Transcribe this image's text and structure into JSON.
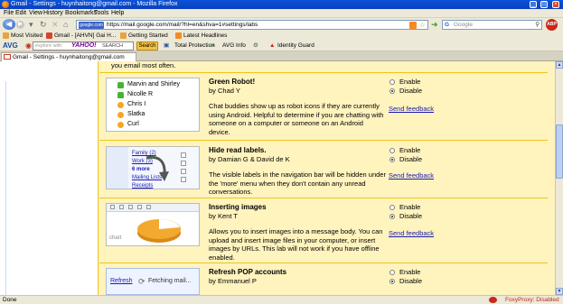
{
  "window": {
    "title": "Gmail - Settings - huynhaitong@gmail.com - Mozilla Firefox",
    "min": "_",
    "max": "□",
    "close": "×"
  },
  "menu": [
    "File",
    "Edit",
    "View",
    "History",
    "Bookmarks",
    "Tools",
    "Help"
  ],
  "nav": {
    "url": "https://mail.google.com/mail/?hl=en&shva=1#settings/labs",
    "site_badge": "google.com",
    "search_placeholder": "Google",
    "search_engine_letter": "G",
    "abp_label": "ABP"
  },
  "bookmarks": [
    "Most Visited",
    "Gmail - [AHVN] Gai H...",
    "Getting Started",
    "Latest Headlines"
  ],
  "toolbar": {
    "avg_label": "AVG",
    "yahoo_placeholder": "explore with",
    "yahoo_brand": "YAHOO!",
    "yahoo_search_label": "SEARCH",
    "search_button": "Search",
    "items": [
      "Total Protection",
      "AVG Info",
      "Identity Guard"
    ]
  },
  "tab": {
    "title": "Gmail - Settings - huynhaitong@gmail.com"
  },
  "content": {
    "top_text": "you email most often.",
    "labs": [
      {
        "title": "Green Robot!",
        "author": "by Chad Y",
        "description": "Chat buddies show up as robot icons if they are currently using Android. Helpful to determine if you are chatting with someone on a computer or someone on an Android device.",
        "enable": "Enable",
        "disable": "Disable",
        "selected": "disable",
        "feedback": "Send feedback",
        "preview": [
          "Marvin and Shirley",
          "Nicolle R",
          "Chris I",
          "Slatka",
          "Curl"
        ]
      },
      {
        "title": "Hide read labels.",
        "author": "by Damian G & David de K",
        "description": "The visible labels in the navigation bar will be hidden under the 'more' menu when they don't contain any unread conversations.",
        "enable": "Enable",
        "disable": "Disable",
        "selected": "disable",
        "feedback": "Send feedback",
        "preview": [
          "Family (2)",
          "Work (3)",
          "6 more",
          "Mailing Lists",
          "Receipts"
        ]
      },
      {
        "title": "Inserting images",
        "author": "by Kent T",
        "description": "Allows you to insert images into a message body. You can upload and insert image files in your computer, or insert images by URLs. This lab will not work if you have offline enabled.",
        "enable": "Enable",
        "disable": "Disable",
        "selected": "disable",
        "feedback": "Send feedback",
        "preview": [
          "chart"
        ]
      },
      {
        "title": "Refresh POP accounts",
        "author": "by Emmanuel P",
        "enable": "Enable",
        "disable": "Disable",
        "selected": "disable",
        "preview": [
          "Refresh",
          "Fetching mail..."
        ]
      }
    ]
  },
  "status": {
    "text": "Done",
    "foxyproxy": "FoxyProxy: Disabled"
  },
  "colors": {
    "panel": "#fff3be",
    "panel_border": "#f0c419",
    "link": "#1a1ab4",
    "titlebar": "#0a53d8"
  }
}
